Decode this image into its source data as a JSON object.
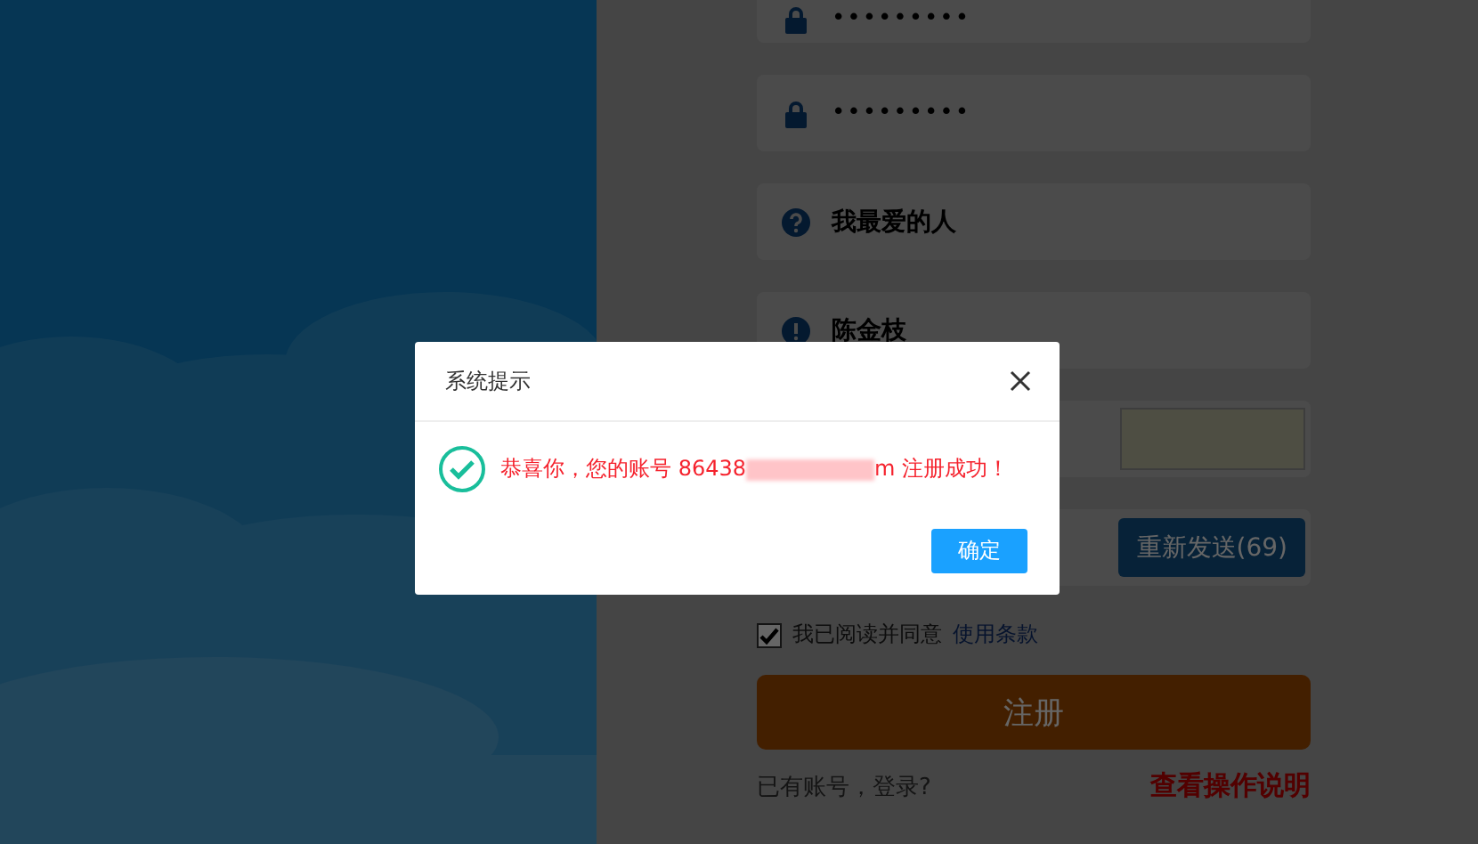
{
  "form": {
    "fields": [
      {
        "kind": "password",
        "value": "•••••••••"
      },
      {
        "kind": "password",
        "value": "•••••••••"
      },
      {
        "kind": "question",
        "value": "我最爱的人"
      },
      {
        "kind": "answer",
        "value": "陈金枝"
      },
      {
        "kind": "captcha"
      },
      {
        "kind": "sms",
        "button": "重新发送(69)"
      }
    ],
    "agree": {
      "checked": true,
      "label": "我已阅读并同意",
      "link": "使用条款"
    },
    "submit": "注册",
    "login_link": "已有账号，登录?",
    "help_link": "查看操作说明"
  },
  "dialog": {
    "title": "系统提示",
    "message_start": "恭喜你，您的账号 86438",
    "message_end": "m 注册成功！",
    "ok": "确定"
  }
}
